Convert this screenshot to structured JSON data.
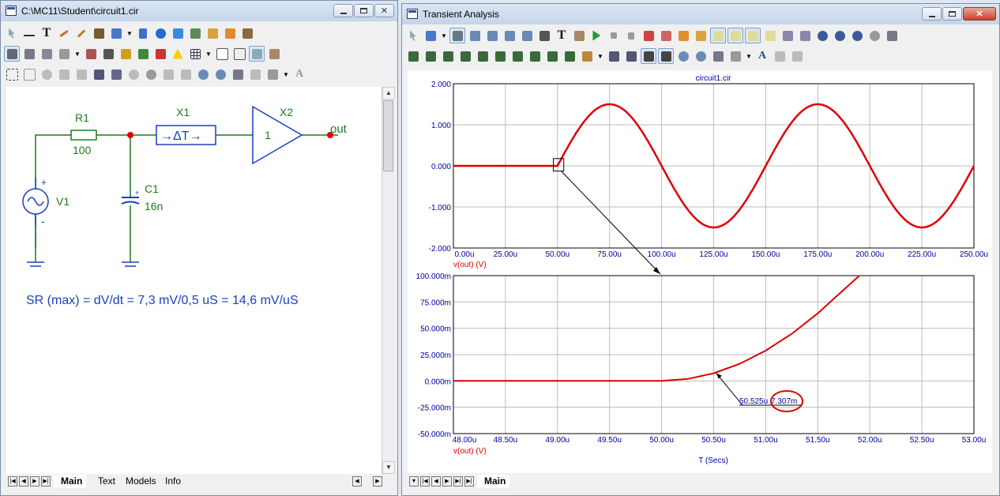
{
  "schematic_window": {
    "title": "C:\\MC11\\Student\\circuit1.cir",
    "components": {
      "r1": {
        "name": "R1",
        "value": "100"
      },
      "c1": {
        "name": "C1",
        "value": "16n"
      },
      "v1": {
        "name": "V1"
      },
      "x1": {
        "name": "X1",
        "symbol": "→ΔT→"
      },
      "x2": {
        "name": "X2",
        "gain": "1"
      },
      "out_node": "out",
      "polarity_plus": "+",
      "polarity_minus": "-",
      "cap_plus": "+"
    },
    "note": "SR (max) = dV/dt = 7,3 mV/0,5 uS = 14,6 mV/uS",
    "tabs": [
      "Main",
      "Text",
      "Models",
      "Info"
    ],
    "active_tab": "Main"
  },
  "analysis_window": {
    "title": "Transient Analysis",
    "tabs": [
      "Main"
    ],
    "active_tab": "Main"
  },
  "colors": {
    "wire": "#1f7a1f",
    "component": "#1a3fc0",
    "trace": "#e00000",
    "grid": "#bdbdbd",
    "axis_label": "#0000a0",
    "note": "#1a3fc0"
  },
  "chart_data": [
    {
      "type": "line",
      "title": "circuit1.cir",
      "xlabel": "",
      "ylabel": "v(out) (V)",
      "xlim": [
        0,
        250
      ],
      "ylim": [
        -2,
        2
      ],
      "x_ticks": [
        "0.00u",
        "25.00u",
        "50.00u",
        "75.00u",
        "100.00u",
        "125.00u",
        "150.00u",
        "175.00u",
        "200.00u",
        "225.00u",
        "250.00u"
      ],
      "y_ticks": [
        "2.000",
        "1.000",
        "0.000",
        "-1.000",
        "-2.000"
      ],
      "series": [
        {
          "name": "v(out) (V)",
          "description": "0 until 50u, then 1.5 V sine with 100u period",
          "points": [
            [
              0,
              0
            ],
            [
              50,
              0
            ],
            [
              75,
              1.5
            ],
            [
              100,
              0
            ],
            [
              125,
              -1.5
            ],
            [
              150,
              0
            ],
            [
              175,
              1.5
            ],
            [
              200,
              0
            ],
            [
              225,
              -1.5
            ],
            [
              250,
              -0.13
            ]
          ]
        }
      ],
      "grid": true,
      "zoom_box": {
        "x": [
          48,
          53
        ],
        "y": [
          -0.05,
          0.1
        ]
      }
    },
    {
      "type": "line",
      "xlabel": "T (Secs)",
      "ylabel": "v(out) (V)",
      "xlim": [
        48,
        53
      ],
      "ylim": [
        -50,
        100
      ],
      "x_ticks": [
        "48.00u",
        "48.50u",
        "49.00u",
        "49.50u",
        "50.00u",
        "50.50u",
        "51.00u",
        "51.50u",
        "52.00u",
        "52.50u",
        "53.00u"
      ],
      "y_ticks": [
        "100.000m",
        "75.000m",
        "50.000m",
        "25.000m",
        "0.000m",
        "-25.000m",
        "-50.000m"
      ],
      "series": [
        {
          "name": "v(out) (V)",
          "points": [
            [
              48,
              0
            ],
            [
              50,
              0
            ],
            [
              50.25,
              1.9
            ],
            [
              50.5,
              7.3
            ],
            [
              50.75,
              16.3
            ],
            [
              51,
              28.8
            ],
            [
              51.25,
              44.8
            ],
            [
              51.5,
              64.2
            ],
            [
              51.75,
              86.7
            ],
            [
              51.9,
              100
            ]
          ]
        }
      ],
      "grid": true,
      "cursor": {
        "x_label": "50.525u",
        "y_label": "7.307m",
        "x": 50.525,
        "y": 7.307
      }
    }
  ]
}
